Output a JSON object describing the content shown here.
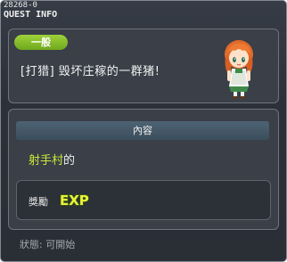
{
  "window": {
    "quest_id": "28268-0",
    "title": "QUEST INFO"
  },
  "quest": {
    "category": "一般",
    "name": "[打猎] 毁坏庄稼的一群猪!",
    "npc_icon": "npc-girl-portrait"
  },
  "content": {
    "header": "內容",
    "desc_highlight": "射手村",
    "desc_suffix": "的"
  },
  "reward": {
    "label": "獎勵",
    "icon": "exp-icon",
    "icon_text": "EXP"
  },
  "status": {
    "text": "狀態: 可開始"
  },
  "colors": {
    "badge_green": "#8bc531",
    "highlight_text": "#cde83a",
    "exp_yellow": "#e8f23a",
    "panel_bg": "#3a3f48"
  }
}
